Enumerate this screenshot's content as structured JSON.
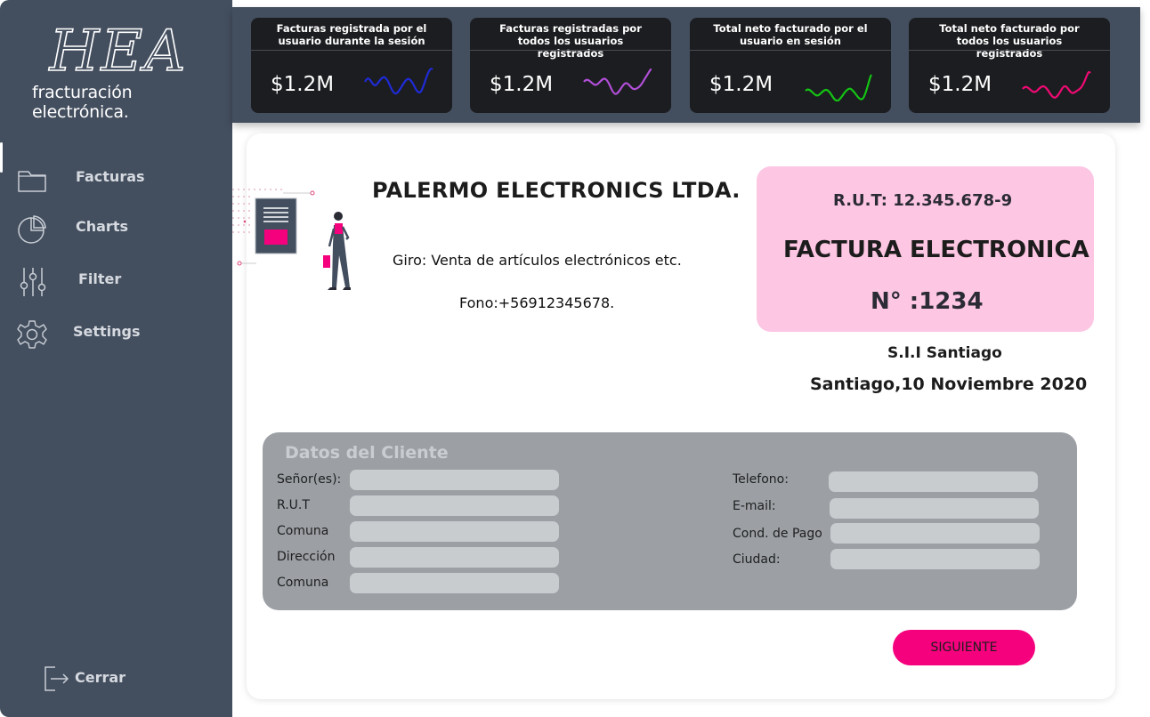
{
  "sidebar": {
    "logo_script": "HEA",
    "logo_sub": "fracturación electrónica.",
    "items": [
      {
        "label": "Facturas",
        "icon": "folder-icon"
      },
      {
        "label": "Charts",
        "icon": "pie-chart-icon"
      },
      {
        "label": "Filter",
        "icon": "sliders-icon"
      },
      {
        "label": "Settings",
        "icon": "gear-icon"
      }
    ],
    "logout_label": "Cerrar"
  },
  "stats": [
    {
      "title": "Facturas registrada por el usuario durante la sesión",
      "value": "$1.2M",
      "color": "#1f2bd8"
    },
    {
      "title": "Facturas registradas por todos los usuarios registrados",
      "value": "$1.2M",
      "color": "#b14fd8"
    },
    {
      "title": "Total neto facturado por el usuario en sesión",
      "value": "$1.2M",
      "color": "#14c414"
    },
    {
      "title": "Total neto facturado por todos los usuarios registrados",
      "value": "$1.2M",
      "color": "#f00a74"
    }
  ],
  "invoice": {
    "company": "PALERMO ELECTRONICS LTDA.",
    "giro": "Giro: Venta de artículos electrónicos etc.",
    "fono": "Fono:+56912345678.",
    "rut": "R.U.T: 12.345.678-9",
    "doc_type": "FACTURA ELECTRONICA",
    "number": "N° :1234",
    "sii": "S.I.I Santiago",
    "date": "Santiago,10 Noviembre 2020"
  },
  "client": {
    "title": "Datos del Cliente",
    "left_fields": [
      {
        "label": "Señor(es):",
        "value": ""
      },
      {
        "label": "R.U.T",
        "value": ""
      },
      {
        "label": "Comuna",
        "value": ""
      },
      {
        "label": "Dirección",
        "value": ""
      },
      {
        "label": "Comuna",
        "value": ""
      }
    ],
    "right_fields": [
      {
        "label": "Telefono:",
        "value": ""
      },
      {
        "label": "E-mail:",
        "value": ""
      },
      {
        "label": "Cond. de Pago",
        "value": ""
      },
      {
        "label": "Ciudad:",
        "value": ""
      }
    ]
  },
  "actions": {
    "next_label": "SIGUIENTE"
  },
  "colors": {
    "sidebar": "#434e5e",
    "accent": "#f5007d",
    "pink_box": "#fdc6e3",
    "client_box": "#9ca0a5"
  }
}
